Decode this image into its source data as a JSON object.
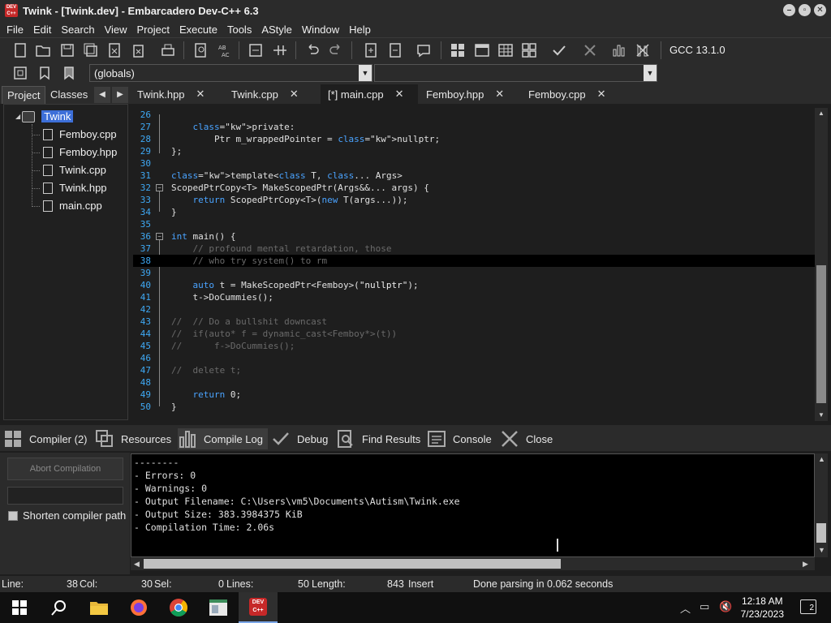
{
  "window": {
    "title": "Twink - [Twink.dev] - Embarcadero Dev-C++ 6.3",
    "app_icon_text": "DEV C++",
    "controls": [
      "minimize",
      "restore",
      "close"
    ]
  },
  "menu": [
    "File",
    "Edit",
    "Search",
    "View",
    "Project",
    "Execute",
    "Tools",
    "AStyle",
    "Window",
    "Help"
  ],
  "toolbar": {
    "compiler": "GCC 13.1.0",
    "scope_combo": "(globals)",
    "member_combo": ""
  },
  "left_panel": {
    "tabs": [
      "Project",
      "Classes"
    ],
    "active_tab": "Project",
    "root": "Twink",
    "files": [
      "Femboy.cpp",
      "Femboy.hpp",
      "Twink.cpp",
      "Twink.hpp",
      "main.cpp"
    ]
  },
  "editor_tabs": [
    {
      "label": "Twink.hpp",
      "active": false
    },
    {
      "label": "Twink.cpp",
      "active": false
    },
    {
      "label": "[*] main.cpp",
      "active": true
    },
    {
      "label": "Femboy.hpp",
      "active": false
    },
    {
      "label": "Femboy.cpp",
      "active": false
    }
  ],
  "code_lines": [
    {
      "n": "26",
      "t": ""
    },
    {
      "n": "27",
      "t": "    private:"
    },
    {
      "n": "28",
      "t": "        Ptr m_wrappedPointer = nullptr;"
    },
    {
      "n": "29",
      "t": "};"
    },
    {
      "n": "30",
      "t": ""
    },
    {
      "n": "31",
      "t": "template<class T, class... Args>"
    },
    {
      "n": "32",
      "t": "ScopedPtrCopy<T> MakeScopedPtr(Args&&... args) {"
    },
    {
      "n": "33",
      "t": "    return ScopedPtrCopy<T>(new T(args...));"
    },
    {
      "n": "34",
      "t": "}"
    },
    {
      "n": "35",
      "t": ""
    },
    {
      "n": "36",
      "t": "int main() {"
    },
    {
      "n": "37",
      "t": "    // profound mental retardation, those"
    },
    {
      "n": "38",
      "t": "    // who try system() to rm"
    },
    {
      "n": "39",
      "t": ""
    },
    {
      "n": "40",
      "t": "    auto t = MakeScopedPtr<Femboy>(\"nullptr\");"
    },
    {
      "n": "41",
      "t": "    t->DoCummies();"
    },
    {
      "n": "42",
      "t": ""
    },
    {
      "n": "43",
      "t": "//  // Do a bullshit downcast"
    },
    {
      "n": "44",
      "t": "//  if(auto* f = dynamic_cast<Femboy*>(t))"
    },
    {
      "n": "45",
      "t": "//      f->DoCummies();"
    },
    {
      "n": "46",
      "t": ""
    },
    {
      "n": "47",
      "t": "//  delete t;"
    },
    {
      "n": "48",
      "t": ""
    },
    {
      "n": "49",
      "t": "    return 0;"
    },
    {
      "n": "50",
      "t": "}"
    }
  ],
  "bottom_tabs": [
    {
      "label": "Compiler (2)",
      "icon": "grid-icon"
    },
    {
      "label": "Resources",
      "icon": "resources-icon"
    },
    {
      "label": "Compile Log",
      "icon": "chart-icon",
      "active": true
    },
    {
      "label": "Debug",
      "icon": "check-icon"
    },
    {
      "label": "Find Results",
      "icon": "find-icon"
    },
    {
      "label": "Console",
      "icon": "console-icon"
    },
    {
      "label": "Close",
      "icon": "close-icon"
    }
  ],
  "compile_panel": {
    "abort_label": "Abort Compilation",
    "shorten_label": "Shorten compiler path"
  },
  "log_lines": [
    "--------",
    "- Errors: 0",
    "- Warnings: 0",
    "- Output Filename: C:\\Users\\vm5\\Documents\\Autism\\Twink.exe",
    "- Output Size: 383.3984375 KiB",
    "- Compilation Time: 2.06s"
  ],
  "status": {
    "line_label": "Line:",
    "line_val": "38",
    "col_label": "Col:",
    "col_val": "30",
    "sel_label": "Sel:",
    "sel_val": "0",
    "lines_label": "Lines:",
    "lines_val": "50",
    "length_label": "Length:",
    "length_val": "843",
    "mode": "Insert",
    "message": "Done parsing in 0.062 seconds"
  },
  "taskbar": {
    "time": "12:18 AM",
    "date": "7/23/2023",
    "notifications": "2"
  }
}
